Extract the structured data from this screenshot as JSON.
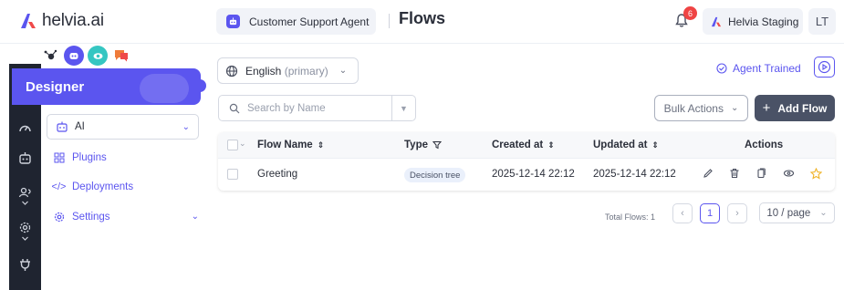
{
  "brand": {
    "name": "helvia.ai",
    "accent": "#5b55ef",
    "dark": "#1f2430"
  },
  "header": {
    "agent_name": "Customer Support Agent",
    "title": "Flows",
    "notifications": "6",
    "workspace": "Helvia Staging",
    "user_initials": "LT"
  },
  "sidebar": {
    "section_title": "Designer",
    "items": [
      {
        "label": "AI",
        "icon": "robot-icon"
      },
      {
        "label": "Plugins",
        "icon": "plugins-icon"
      },
      {
        "label": "Deployments",
        "icon": "code-icon"
      },
      {
        "label": "Settings",
        "icon": "gear-icon"
      }
    ]
  },
  "toolbar": {
    "language": "English",
    "language_suffix": "(primary)",
    "trained_status": "Agent Trained",
    "search_placeholder": "Search by Name",
    "bulk_actions": "Bulk Actions",
    "add_flow": "Add Flow"
  },
  "table": {
    "columns": [
      "Flow Name",
      "Type",
      "Created at",
      "Updated at",
      "Actions"
    ],
    "rows": [
      {
        "name": "Greeting",
        "type": "Decision tree",
        "created": "2025-12-14 22:12",
        "updated": "2025-12-14 22:12"
      }
    ]
  },
  "pagination": {
    "total_label": "Total Flows: 1",
    "current_page": "1",
    "page_size": "10 / page"
  }
}
